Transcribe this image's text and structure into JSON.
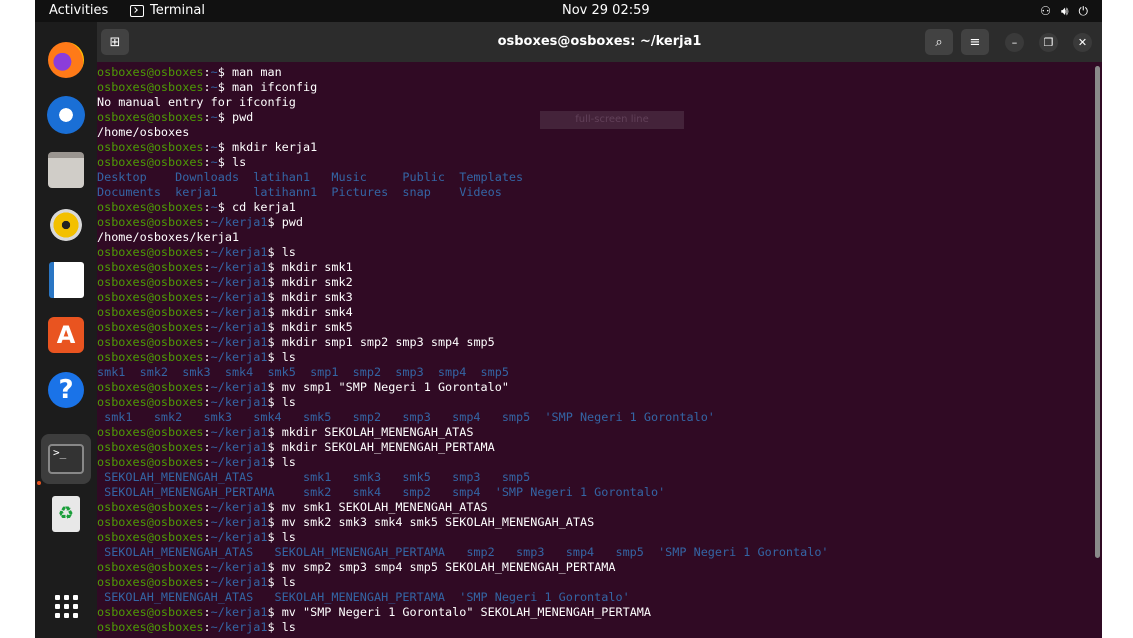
{
  "topbar": {
    "activities": "Activities",
    "app_name": "Terminal",
    "clock": "Nov 29  02:59",
    "tray": [
      "network-icon",
      "volume-icon",
      "power-icon"
    ]
  },
  "dock": {
    "items": [
      "firefox-icon",
      "thunderbird-icon",
      "files-icon",
      "rhythmbox-icon",
      "libreoffice-writer-icon",
      "app-center-icon",
      "help-icon",
      "terminal-icon",
      "trash-icon",
      "show-apps-icon"
    ],
    "help_glyph": "?",
    "store_glyph": "A",
    "terminal_glyph": ">_",
    "trash_glyph": "♻"
  },
  "window": {
    "title": "osboxes@osboxes: ~/kerja1",
    "tooltip": "full-screen line"
  },
  "colors": {
    "terminal_bg": "#300a24",
    "prompt_user": "#4e9a06",
    "prompt_path": "#3465a4",
    "directory": "#3465a4",
    "accent": "#e95420"
  },
  "terminal": {
    "lines": [
      {
        "user": "osboxes@osboxes",
        "path": "~",
        "cmd": "man man"
      },
      {
        "user": "osboxes@osboxes",
        "path": "~",
        "cmd": "man ifconfig"
      },
      {
        "out": "No manual entry for ifconfig"
      },
      {
        "user": "osboxes@osboxes",
        "path": "~",
        "cmd": "pwd"
      },
      {
        "out": "/home/osboxes"
      },
      {
        "user": "osboxes@osboxes",
        "path": "~",
        "cmd": "mkdir kerja1"
      },
      {
        "user": "osboxes@osboxes",
        "path": "~",
        "cmd": "ls"
      },
      {
        "dirs": "Desktop    Downloads  latihan1   Music     Public  Templates"
      },
      {
        "dirs": "Documents  kerja1     latihann1  Pictures  snap    Videos"
      },
      {
        "user": "osboxes@osboxes",
        "path": "~",
        "cmd": "cd kerja1"
      },
      {
        "user": "osboxes@osboxes",
        "path": "~/kerja1",
        "cmd": "pwd"
      },
      {
        "out": "/home/osboxes/kerja1"
      },
      {
        "user": "osboxes@osboxes",
        "path": "~/kerja1",
        "cmd": "ls"
      },
      {
        "user": "osboxes@osboxes",
        "path": "~/kerja1",
        "cmd": "mkdir smk1"
      },
      {
        "user": "osboxes@osboxes",
        "path": "~/kerja1",
        "cmd": "mkdir smk2"
      },
      {
        "user": "osboxes@osboxes",
        "path": "~/kerja1",
        "cmd": "mkdir smk3"
      },
      {
        "user": "osboxes@osboxes",
        "path": "~/kerja1",
        "cmd": "mkdir smk4"
      },
      {
        "user": "osboxes@osboxes",
        "path": "~/kerja1",
        "cmd": "mkdir smk5"
      },
      {
        "user": "osboxes@osboxes",
        "path": "~/kerja1",
        "cmd": "mkdir smp1 smp2 smp3 smp4 smp5"
      },
      {
        "user": "osboxes@osboxes",
        "path": "~/kerja1",
        "cmd": "ls"
      },
      {
        "dirs": "smk1  smk2  smk3  smk4  smk5  smp1  smp2  smp3  smp4  smp5"
      },
      {
        "user": "osboxes@osboxes",
        "path": "~/kerja1",
        "cmd": "mv smp1 \"SMP Negeri 1 Gorontalo\""
      },
      {
        "user": "osboxes@osboxes",
        "path": "~/kerja1",
        "cmd": "ls"
      },
      {
        "dirs": " smk1   smk2   smk3   smk4   smk5   smp2   smp3   smp4   smp5  'SMP Negeri 1 Gorontalo'"
      },
      {
        "user": "osboxes@osboxes",
        "path": "~/kerja1",
        "cmd": "mkdir SEKOLAH_MENENGAH_ATAS"
      },
      {
        "user": "osboxes@osboxes",
        "path": "~/kerja1",
        "cmd": "mkdir SEKOLAH_MENENGAH_PERTAMA"
      },
      {
        "user": "osboxes@osboxes",
        "path": "~/kerja1",
        "cmd": "ls"
      },
      {
        "dirs": " SEKOLAH_MENENGAH_ATAS       smk1   smk3   smk5   smp3   smp5"
      },
      {
        "dirs": " SEKOLAH_MENENGAH_PERTAMA    smk2   smk4   smp2   smp4  'SMP Negeri 1 Gorontalo'"
      },
      {
        "user": "osboxes@osboxes",
        "path": "~/kerja1",
        "cmd": "mv smk1 SEKOLAH_MENENGAH_ATAS"
      },
      {
        "user": "osboxes@osboxes",
        "path": "~/kerja1",
        "cmd": "mv smk2 smk3 smk4 smk5 SEKOLAH_MENENGAH_ATAS"
      },
      {
        "user": "osboxes@osboxes",
        "path": "~/kerja1",
        "cmd": "ls"
      },
      {
        "dirs": " SEKOLAH_MENENGAH_ATAS   SEKOLAH_MENENGAH_PERTAMA   smp2   smp3   smp4   smp5  'SMP Negeri 1 Gorontalo'"
      },
      {
        "user": "osboxes@osboxes",
        "path": "~/kerja1",
        "cmd": "mv smp2 smp3 smp4 smp5 SEKOLAH_MENENGAH_PERTAMA"
      },
      {
        "user": "osboxes@osboxes",
        "path": "~/kerja1",
        "cmd": "ls"
      },
      {
        "dirs": " SEKOLAH_MENENGAH_ATAS   SEKOLAH_MENENGAH_PERTAMA  'SMP Negeri 1 Gorontalo'"
      },
      {
        "user": "osboxes@osboxes",
        "path": "~/kerja1",
        "cmd": "mv \"SMP Negeri 1 Gorontalo\" SEKOLAH_MENENGAH_PERTAMA"
      },
      {
        "user": "osboxes@osboxes",
        "path": "~/kerja1",
        "cmd": "ls"
      }
    ]
  }
}
